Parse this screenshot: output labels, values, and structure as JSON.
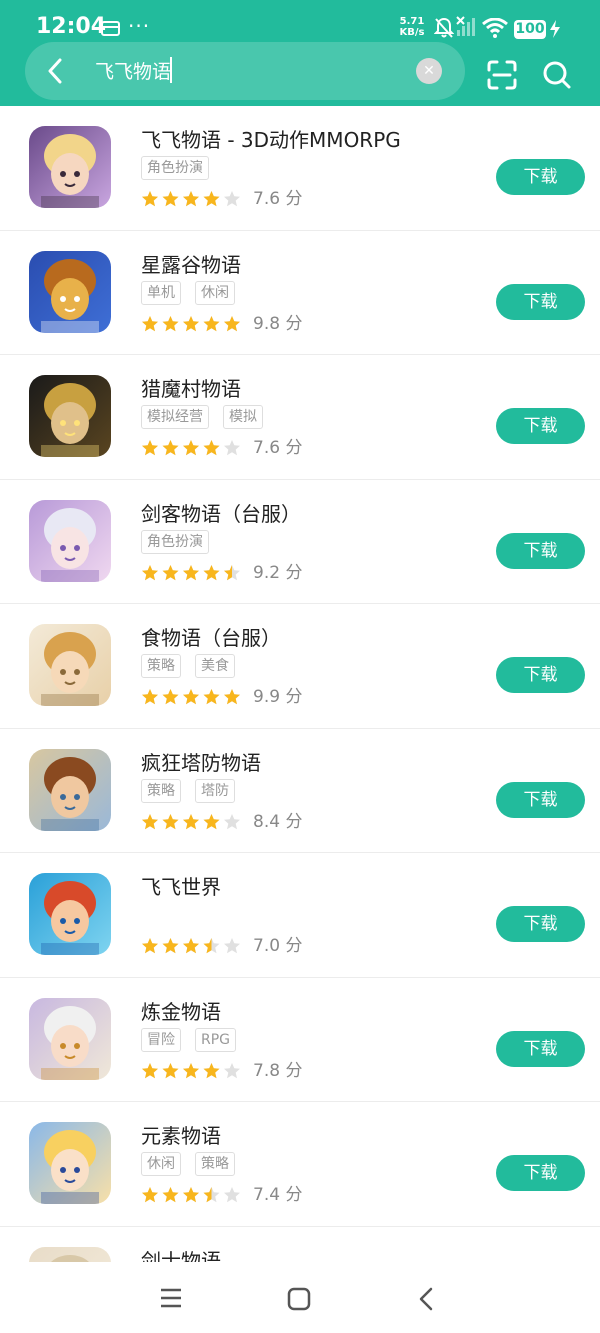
{
  "status_bar": {
    "time": "12:04",
    "dots": "···",
    "net_speed_value": "5.71",
    "net_speed_unit": "KB/s",
    "battery": "100"
  },
  "search": {
    "query": "飞飞物语"
  },
  "colors": {
    "accent": "#22bb9c",
    "star_on": "#f8b61d",
    "star_off": "#e0e0e0"
  },
  "apps": [
    {
      "name": "飞飞物语 - 3D动作MMORPG",
      "tags": [
        "角色扮演"
      ],
      "rating": 4,
      "score": "7.6 分",
      "button": "下载",
      "icon": "anime-girl-pirate-hat-icon"
    },
    {
      "name": "星露谷物语",
      "tags": [
        "单机",
        "休闲"
      ],
      "rating": 5,
      "score": "9.8 分",
      "button": "下载",
      "icon": "pixel-chicken-icon"
    },
    {
      "name": "猎魔村物语",
      "tags": [
        "模拟经营",
        "模拟"
      ],
      "rating": 4,
      "score": "7.6 分",
      "button": "下载",
      "icon": "pixel-warrior-icon"
    },
    {
      "name": "剑客物语（台服）",
      "tags": [
        "角色扮演"
      ],
      "rating": 4.5,
      "score": "9.2 分",
      "button": "下载",
      "icon": "anime-white-hair-girl-icon"
    },
    {
      "name": "食物语（台服）",
      "tags": [
        "策略",
        "美食"
      ],
      "rating": 5,
      "score": "9.9 分",
      "button": "下载",
      "icon": "food-story-character-icon"
    },
    {
      "name": "疯狂塔防物语",
      "tags": [
        "策略",
        "塔防"
      ],
      "rating": 4,
      "score": "8.4 分",
      "button": "下载",
      "icon": "cartoon-warrior-boy-icon"
    },
    {
      "name": "飞飞世界",
      "tags": [],
      "rating": 3.5,
      "score": "7.0 分",
      "button": "下载",
      "icon": "cartoon-boy-blue-helmet-icon"
    },
    {
      "name": "炼金物语",
      "tags": [
        "冒险",
        "RPG"
      ],
      "rating": 4,
      "score": "7.8 分",
      "button": "下载",
      "icon": "anniversary-character-icon"
    },
    {
      "name": "元素物语",
      "tags": [
        "休闲",
        "策略"
      ],
      "rating": 3.5,
      "score": "7.4 分",
      "button": "下载",
      "icon": "winking-blonde-girl-icon"
    },
    {
      "name": "剑士物语",
      "tags": [],
      "rating": 0,
      "score": "",
      "button": "",
      "icon": "swordsman-character-icon"
    }
  ]
}
